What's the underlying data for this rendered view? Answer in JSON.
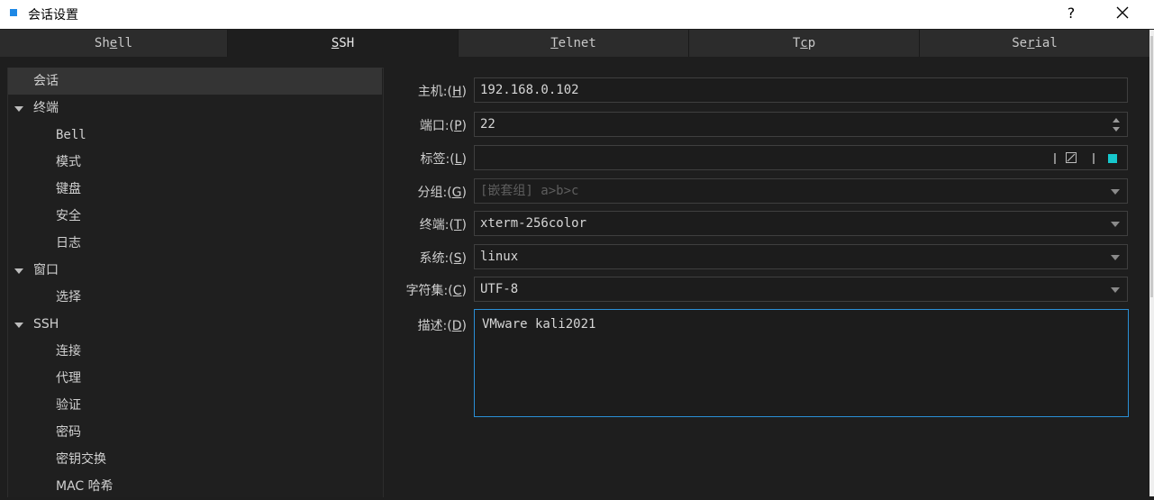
{
  "window": {
    "title": "会话设置",
    "help": "?"
  },
  "tabs": [
    {
      "pre": "Sh",
      "key": "e",
      "post": "ll"
    },
    {
      "pre": "",
      "key": "S",
      "post": "SH"
    },
    {
      "pre": "",
      "key": "T",
      "post": "elnet"
    },
    {
      "pre": "T",
      "key": "c",
      "post": "p"
    },
    {
      "pre": "Se",
      "key": "r",
      "post": "ial"
    }
  ],
  "active_tab": "SSH",
  "tree": [
    "会话",
    "终端",
    "Bell",
    "模式",
    "键盘",
    "安全",
    "日志",
    "窗口",
    "选择",
    "SSH",
    "连接",
    "代理",
    "验证",
    "密码",
    "密钥交换",
    "MAC 哈希"
  ],
  "form": {
    "host": {
      "label": "主机:(",
      "key": "H",
      "end": ")",
      "value": "192.168.0.102"
    },
    "port": {
      "label": "端口:(",
      "key": "P",
      "end": ")",
      "value": "22"
    },
    "tag": {
      "label": "标签:(",
      "key": "L",
      "end": ")",
      "value": ""
    },
    "group": {
      "label": "分组:(",
      "key": "G",
      "end": ")",
      "placeholder": "[嵌套组] a>b>c"
    },
    "terminal": {
      "label": "终端:(",
      "key": "T",
      "end": ")",
      "value": "xterm-256color"
    },
    "system": {
      "label": "系统:(",
      "key": "S",
      "end": ")",
      "value": "linux"
    },
    "charset": {
      "label": "字符集:(",
      "key": "C",
      "end": ")",
      "value": "UTF-8"
    },
    "desc": {
      "label": "描述:(",
      "key": "D",
      "end": ")",
      "value": "VMware kali2021"
    }
  },
  "colors": {
    "accent": "#2a8fd6",
    "tag_color": "#16c7cc",
    "app_icon": "#1e88e5"
  },
  "icons": [
    "app-icon",
    "help-icon",
    "close-icon",
    "clear-icon",
    "chevron-down-icon",
    "spin-up-icon",
    "spin-down-icon"
  ]
}
